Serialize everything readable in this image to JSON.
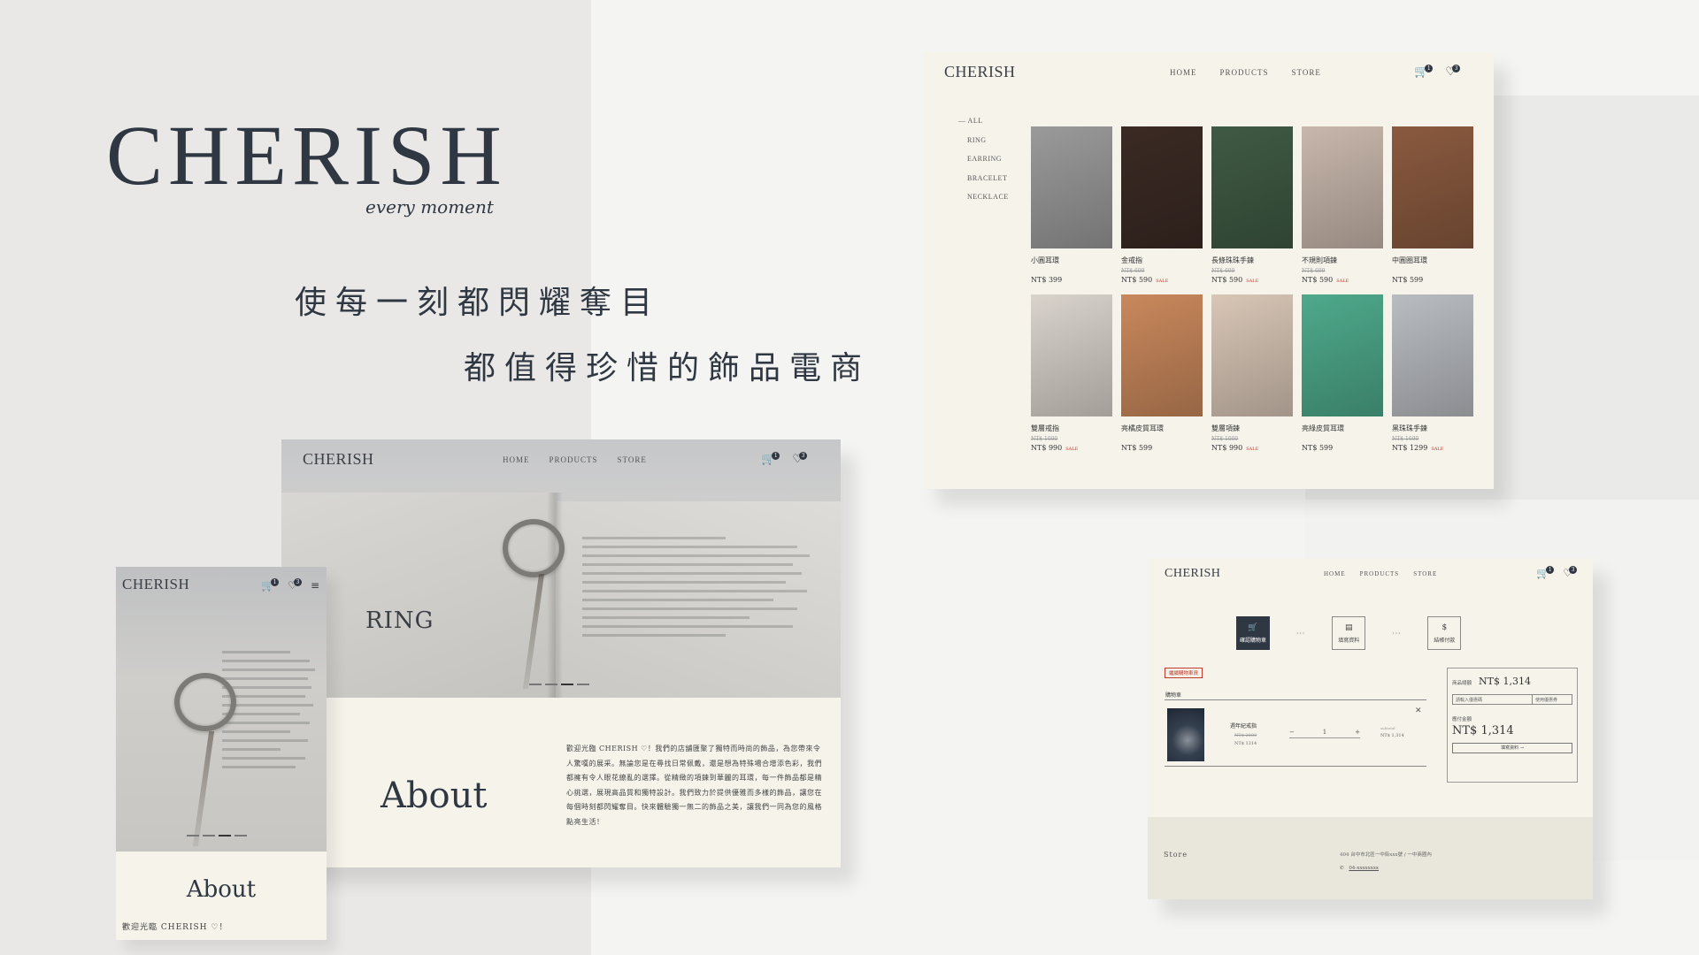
{
  "brand": {
    "logo": "CHERISH",
    "tagline": "every moment",
    "slogan_line1": "使每一刻都閃耀奪目",
    "slogan_line2": "都值得珍惜的飾品電商"
  },
  "nav": {
    "home": "HOME",
    "products": "PRODUCTS",
    "store": "STORE"
  },
  "badges": {
    "cart": "1",
    "wishlist": "3"
  },
  "products_page": {
    "logo": "CHERISH",
    "categories": [
      "— ALL",
      "RING",
      "EARRING",
      "BRACELET",
      "NECKLACE"
    ],
    "items": [
      {
        "name": "小圓耳環",
        "old_price": "",
        "price": "NT$ 399",
        "sale": "",
        "img_color": "#9a9a9a"
      },
      {
        "name": "金戒指",
        "old_price": "NT$ 699",
        "price": "NT$ 590",
        "sale": "SALE",
        "img_color": "#3b2a24"
      },
      {
        "name": "長條珠珠手鍊",
        "old_price": "NT$ 699",
        "price": "NT$ 590",
        "sale": "SALE",
        "img_color": "#3f5a44"
      },
      {
        "name": "不規則項鍊",
        "old_price": "NT$ 699",
        "price": "NT$ 590",
        "sale": "SALE",
        "img_color": "#c8b7ac"
      },
      {
        "name": "中圓圈耳環",
        "old_price": "",
        "price": "NT$ 599",
        "sale": "",
        "img_color": "#8a5a3f"
      },
      {
        "name": "雙層戒指",
        "old_price": "NT$ 1000",
        "price": "NT$ 990",
        "sale": "SALE",
        "img_color": "#d9d3cc"
      },
      {
        "name": "亮橘皮質耳環",
        "old_price": "",
        "price": "NT$ 599",
        "sale": "",
        "img_color": "#c9885c"
      },
      {
        "name": "雙層項鍊",
        "old_price": "NT$ 1000",
        "price": "NT$ 990",
        "sale": "SALE",
        "img_color": "#d8c6b6"
      },
      {
        "name": "亮綠皮質耳環",
        "old_price": "",
        "price": "NT$ 599",
        "sale": "",
        "img_color": "#4ea98b"
      },
      {
        "name": "黑珠珠手鍊",
        "old_price": "NT$ 1699",
        "price": "NT$ 1299",
        "sale": "SALE",
        "img_color": "#b9bcc1"
      }
    ]
  },
  "desktop_page": {
    "logo": "CHERISH",
    "hero_title": "RING",
    "about_title": "About",
    "about_body": "歡迎光臨 CHERISH ♡！我們的店舖匯聚了獨特而時尚的飾品，為您帶來令人驚嘆的展采。無論您是在尋找日常佩戴，還是想為特殊場合增添色彩，我們都擁有令人眼花繚亂的選擇。從精緻的項鍊到華麗的耳環，每一件飾品都是精心挑選，展現高品質和獨特設計。我們致力於提供優雅而多樣的飾品，讓您在每個時刻都閃耀奪目。快來體驗獨一無二的飾品之美，讓我們一同為您的風格點亮生活！"
  },
  "mobile_page": {
    "logo": "CHERISH",
    "menu_icon": "≡",
    "about_title": "About",
    "about_body": "歡迎光臨 CHERISH ♡！"
  },
  "cart_page": {
    "logo": "CHERISH",
    "steps": [
      {
        "icon": "🛒",
        "label": "確認購物車",
        "active": true
      },
      {
        "icon": "▤",
        "label": "填寫資料",
        "active": false
      },
      {
        "icon": "$",
        "label": "結帳付款",
        "active": false
      }
    ],
    "step_separator": "›››",
    "tag": "繼續購物車資",
    "list_header": "購物車",
    "item": {
      "name": "週年紀戒指",
      "old_price": "NT$ 2000",
      "price": "NT$ 1314",
      "qty": "1",
      "minus": "−",
      "plus": "+",
      "subtotal_label": "subtotal",
      "subtotal": "NT$ 1,314",
      "remove": "✕"
    },
    "summary": {
      "goods_label": "商品總額",
      "goods_value": "NT$ 1,314",
      "coupon_placeholder": "請輸入優惠碼",
      "coupon_button": "使用優惠券",
      "total_label": "應付金額",
      "total_value": "NT$ 1,314",
      "checkout": "填寫資料 →"
    },
    "footer": {
      "store": "Store",
      "address": "404 台中市北區一中街xxx號 / 一中商圈內",
      "phone_icon": "✆",
      "phone": "04-xxxxxxxx"
    }
  }
}
